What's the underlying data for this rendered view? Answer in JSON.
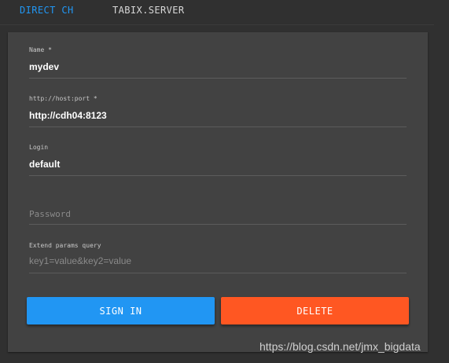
{
  "tabs": [
    {
      "label": "DIRECT CH",
      "active": true
    },
    {
      "label": "TABIX.SERVER",
      "active": false
    }
  ],
  "form": {
    "name": {
      "label": "Name *",
      "value": "mydev"
    },
    "host": {
      "label": "http://host:port *",
      "value": "http://cdh04:8123"
    },
    "login": {
      "label": "Login",
      "value": "default"
    },
    "password": {
      "placeholder": "Password",
      "value": ""
    },
    "params": {
      "label": "Extend params query",
      "placeholder": "key1=value&key2=value",
      "value": ""
    }
  },
  "buttons": {
    "sign_in": "SIGN IN",
    "delete": "DELETE"
  },
  "watermark": "https://blog.csdn.net/jmx_bigdata",
  "colors": {
    "background": "#303030",
    "card": "#424242",
    "accent_blue": "#2196f3",
    "accent_orange": "#ff5722"
  }
}
